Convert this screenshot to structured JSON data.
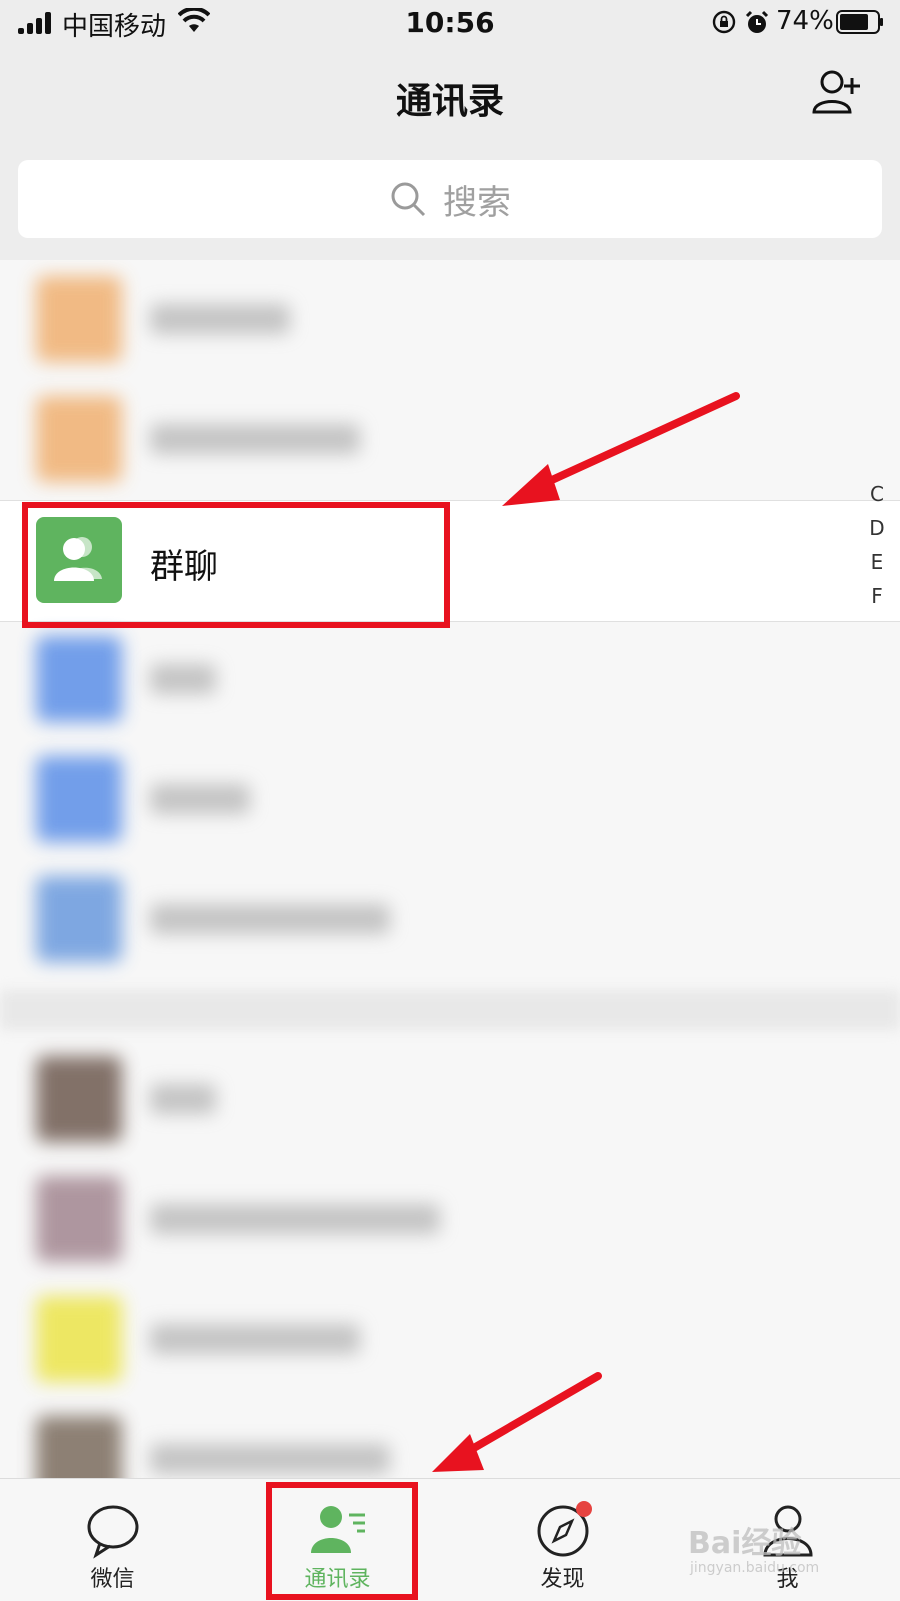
{
  "status_bar": {
    "carrier": "中国移动",
    "time": "10:56",
    "battery_pct": "74%"
  },
  "nav": {
    "title": "通讯录",
    "add_contact_icon": "add-contact-icon"
  },
  "search": {
    "placeholder": "搜索",
    "icon": "search-icon"
  },
  "contacts": {
    "group_chat_label": "群聊",
    "group_chat_color": "#5fb45f"
  },
  "index_letters": [
    "C",
    "D",
    "E",
    "F"
  ],
  "tabbar": {
    "tabs": [
      {
        "label": "微信",
        "icon": "chat-bubble-icon"
      },
      {
        "label": "通讯录",
        "icon": "contacts-icon"
      },
      {
        "label": "发现",
        "icon": "compass-icon"
      },
      {
        "label": "我",
        "icon": "person-icon"
      }
    ],
    "active_color": "#5fb45f",
    "badge_color": "#e64340"
  },
  "watermark": {
    "brand": "Bai经验",
    "sub": "jingyan.baidu.com"
  },
  "annotation_color": "#e8121f"
}
